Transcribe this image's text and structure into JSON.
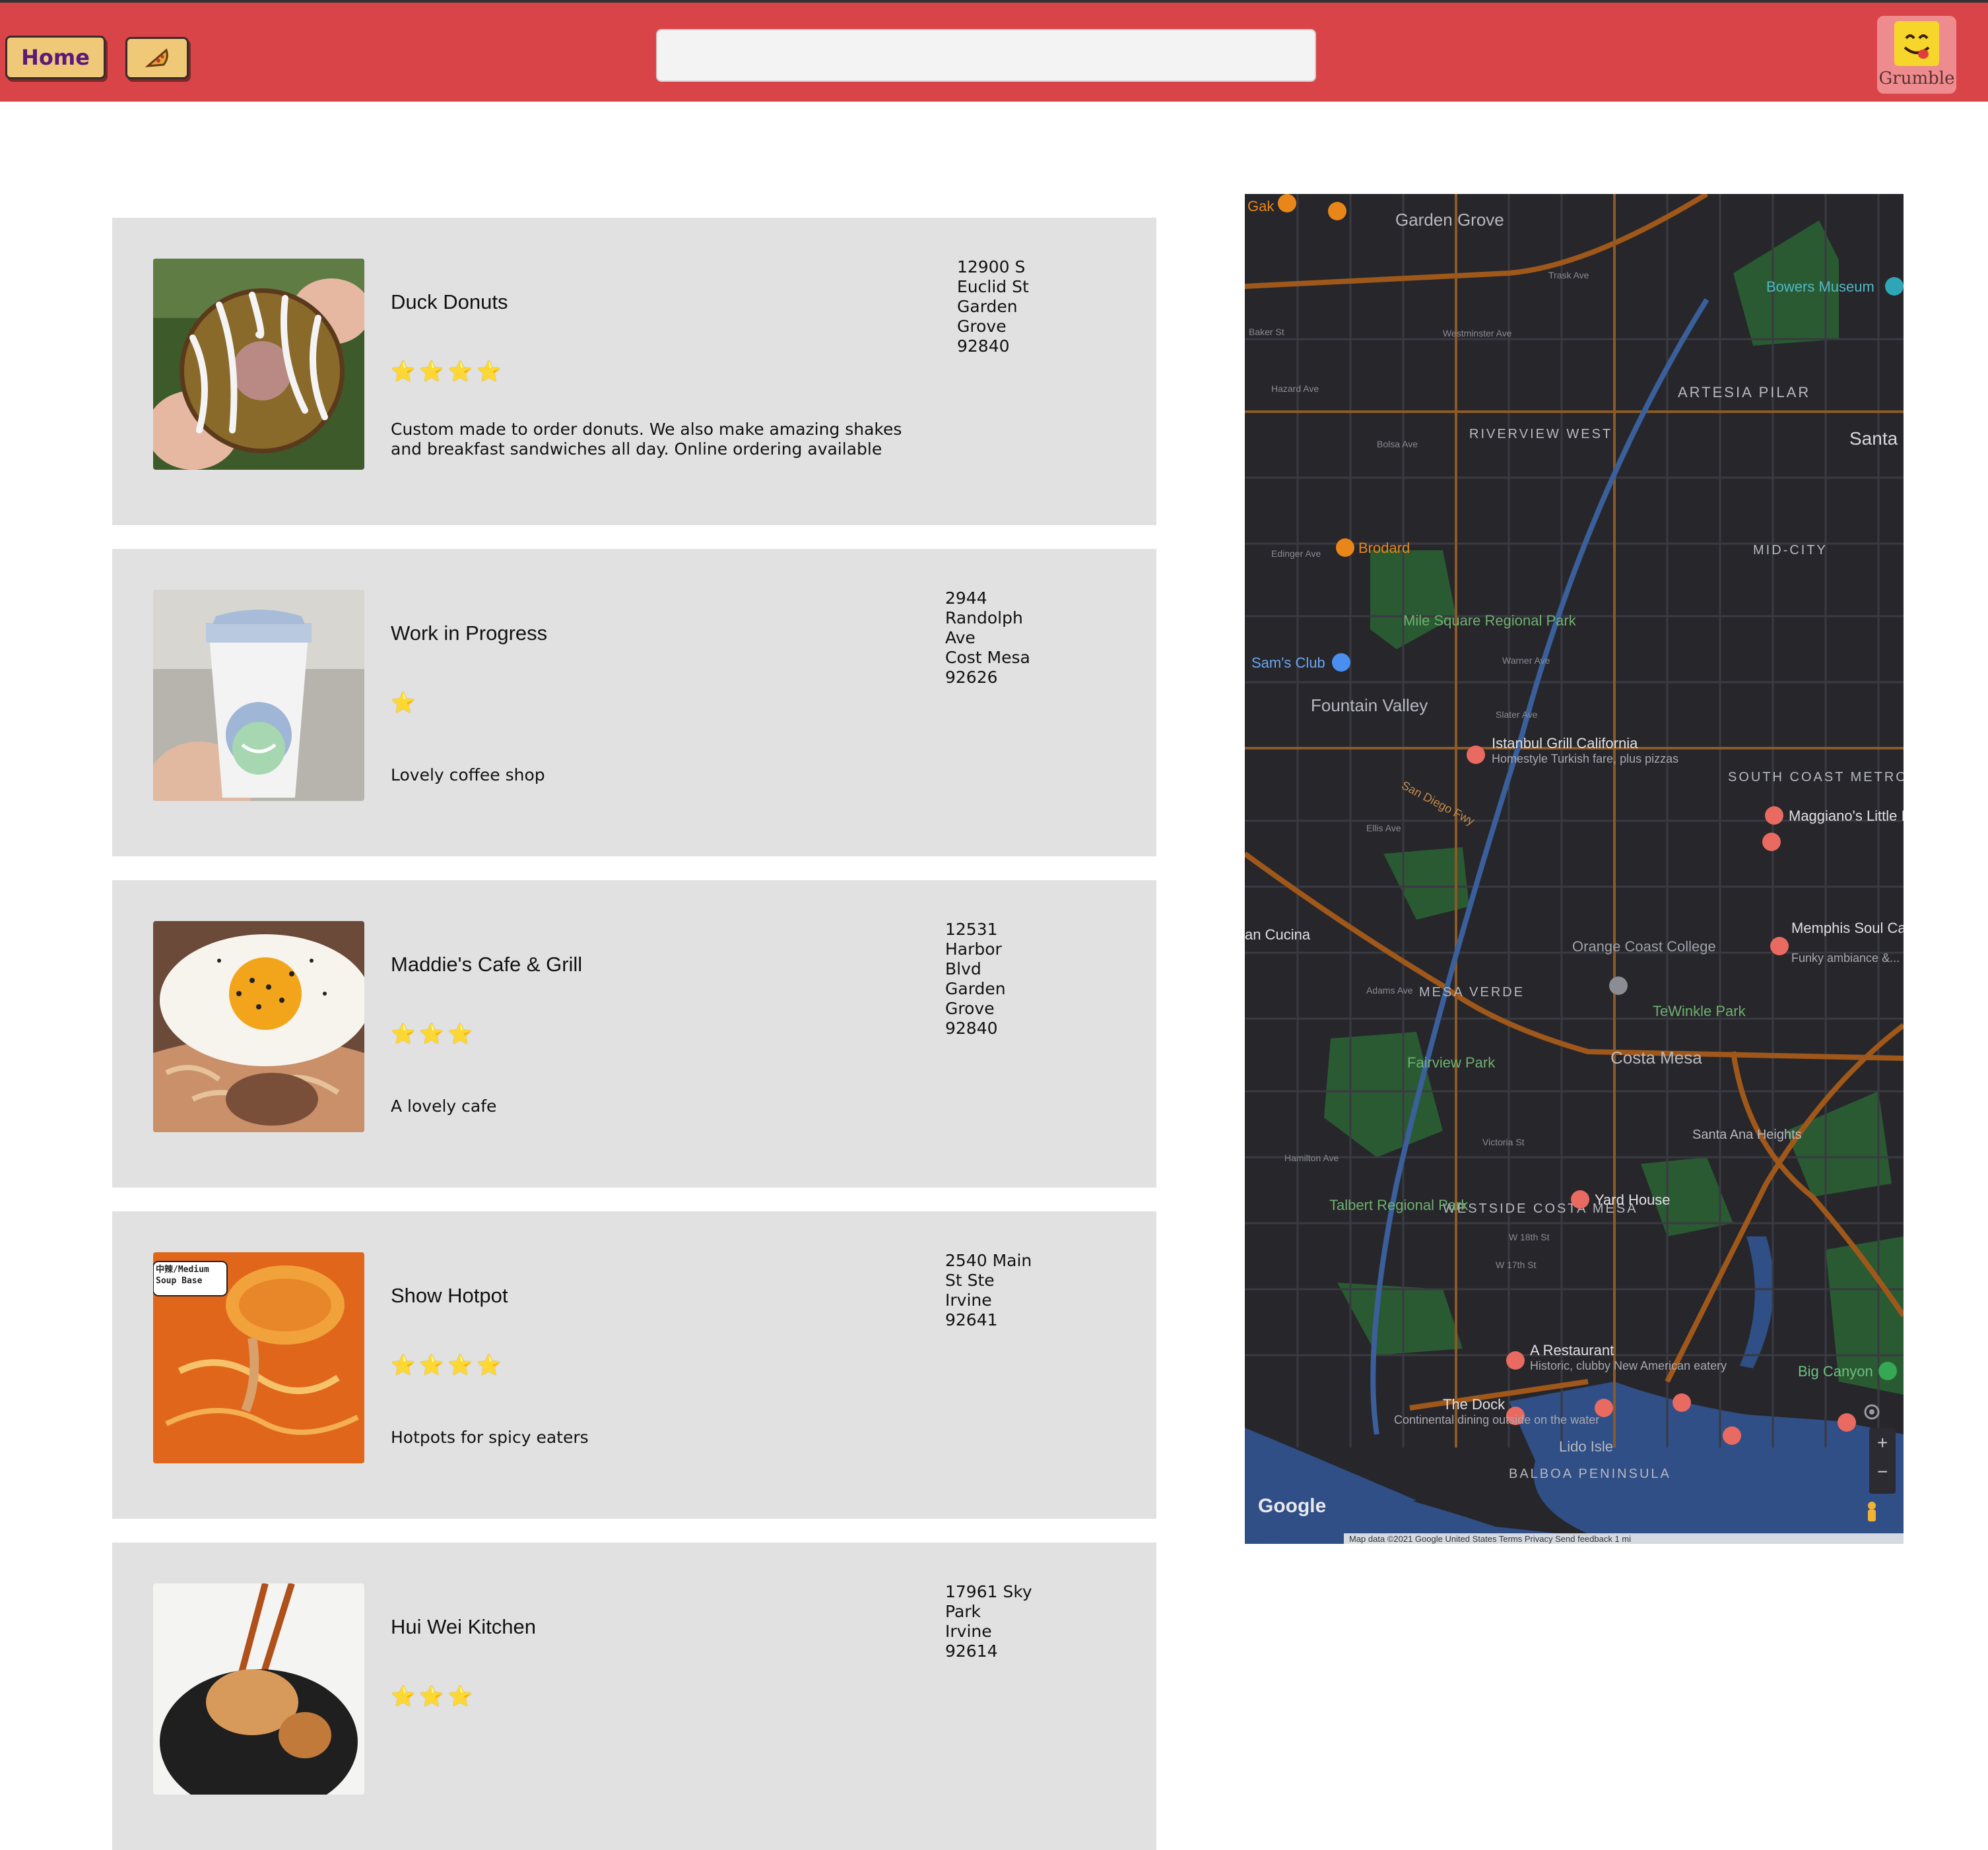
{
  "header": {
    "home_label": "Home",
    "pizza_icon": "pizza-slice-icon",
    "search": {
      "value": "",
      "placeholder": ""
    },
    "brand_name": "Grumble",
    "colors": {
      "bar": "#d94448",
      "button": "#efc878",
      "brand_tile": "#ee8b8e",
      "logo": "#f6d62a"
    }
  },
  "restaurants": [
    {
      "name": "Duck Donuts",
      "stars": 4,
      "star_text": "⭐⭐⭐⭐",
      "description": "Custom made to order donuts. We also make amazing shakes and breakfast sandwiches all day. Online ordering available",
      "address": "12900 S\nEuclid St\nGarden\nGrove\n92840",
      "image": "donut-photo"
    },
    {
      "name": "Work in Progress",
      "stars": 1,
      "star_text": "⭐",
      "description": "Lovely coffee shop",
      "address": "2944\nRandolph\nAve\nCost Mesa\n92626",
      "image": "coffee-cup-photo"
    },
    {
      "name": "Maddie's Cafe & Grill",
      "stars": 3,
      "star_text": "⭐⭐⭐",
      "description": "A lovely cafe",
      "address": "12531\nHarbor\nBlvd\nGarden\nGrove\n92840",
      "image": "fried-egg-bowl-photo"
    },
    {
      "name": "Show Hotpot",
      "stars": 4,
      "star_text": "⭐⭐⭐⭐",
      "description": "Hotpots for spicy eaters",
      "address": "2540 Main\nSt Ste\nIrvine\n92641",
      "image": "hotpot-photo",
      "image_tag": "中辣/Medium\nSoup Base"
    },
    {
      "name": "Hui Wei Kitchen",
      "stars": 3,
      "star_text": "⭐⭐⭐",
      "description": "",
      "address": "17961 Sky\nPark\nIrvine\n92614",
      "image": "chopsticks-dish-photo"
    }
  ],
  "map": {
    "areas": [
      "Garden Grove",
      "ARTESIA PILAR",
      "RIVERVIEW WEST",
      "MID-CITY",
      "Santa",
      "Fountain Valley",
      "SOUTH COAST METRO",
      "MESA VERDE",
      "Costa Mesa",
      "WESTSIDE COSTA MESA",
      "BALBOA PENINSULA",
      "Santa Ana Heights",
      "Lido Isle"
    ],
    "parks": [
      "Mile Square Regional Park",
      "Fairview Park",
      "Talbert Regional Park",
      "TeWinkle Park"
    ],
    "places": [
      {
        "name": "Gak"
      },
      {
        "name": "Brodard"
      },
      {
        "name": "Sam's Club"
      },
      {
        "name": "Bowers Museum"
      },
      {
        "name": "Orange Coast College"
      },
      {
        "name": "Istanbul Grill California",
        "sub": "Homestyle Turkish fare, plus pizzas"
      },
      {
        "name": "Maggiano's Little I"
      },
      {
        "name": "Memphis Soul Cafe & Bar",
        "sub": "Funky ambiance &..."
      },
      {
        "name": "Yard House"
      },
      {
        "name": "A Restaurant",
        "sub": "Historic, clubby New American eatery"
      },
      {
        "name": "The Dock",
        "sub": "Continental dining outside on the water"
      },
      {
        "name": "Big Canyon"
      },
      {
        "name": "an Cucina"
      }
    ],
    "road_labels": [
      "Trask Ave",
      "Westminster Ave",
      "Hazard Ave",
      "Bolsa Ave",
      "Edinger Ave",
      "Warner Ave",
      "Slater Ave",
      "San Diego Fwy",
      "Ellis Ave",
      "Adams Ave",
      "Hamilton Ave",
      "Victoria St",
      "W 17th St",
      "W 18th St",
      "Baker St"
    ],
    "footer": "Map data ©2021 Google   United States   Terms   Privacy   Send feedback   1 mi",
    "google_logo": "Google",
    "zoom_plus": "+",
    "zoom_minus": "−"
  }
}
